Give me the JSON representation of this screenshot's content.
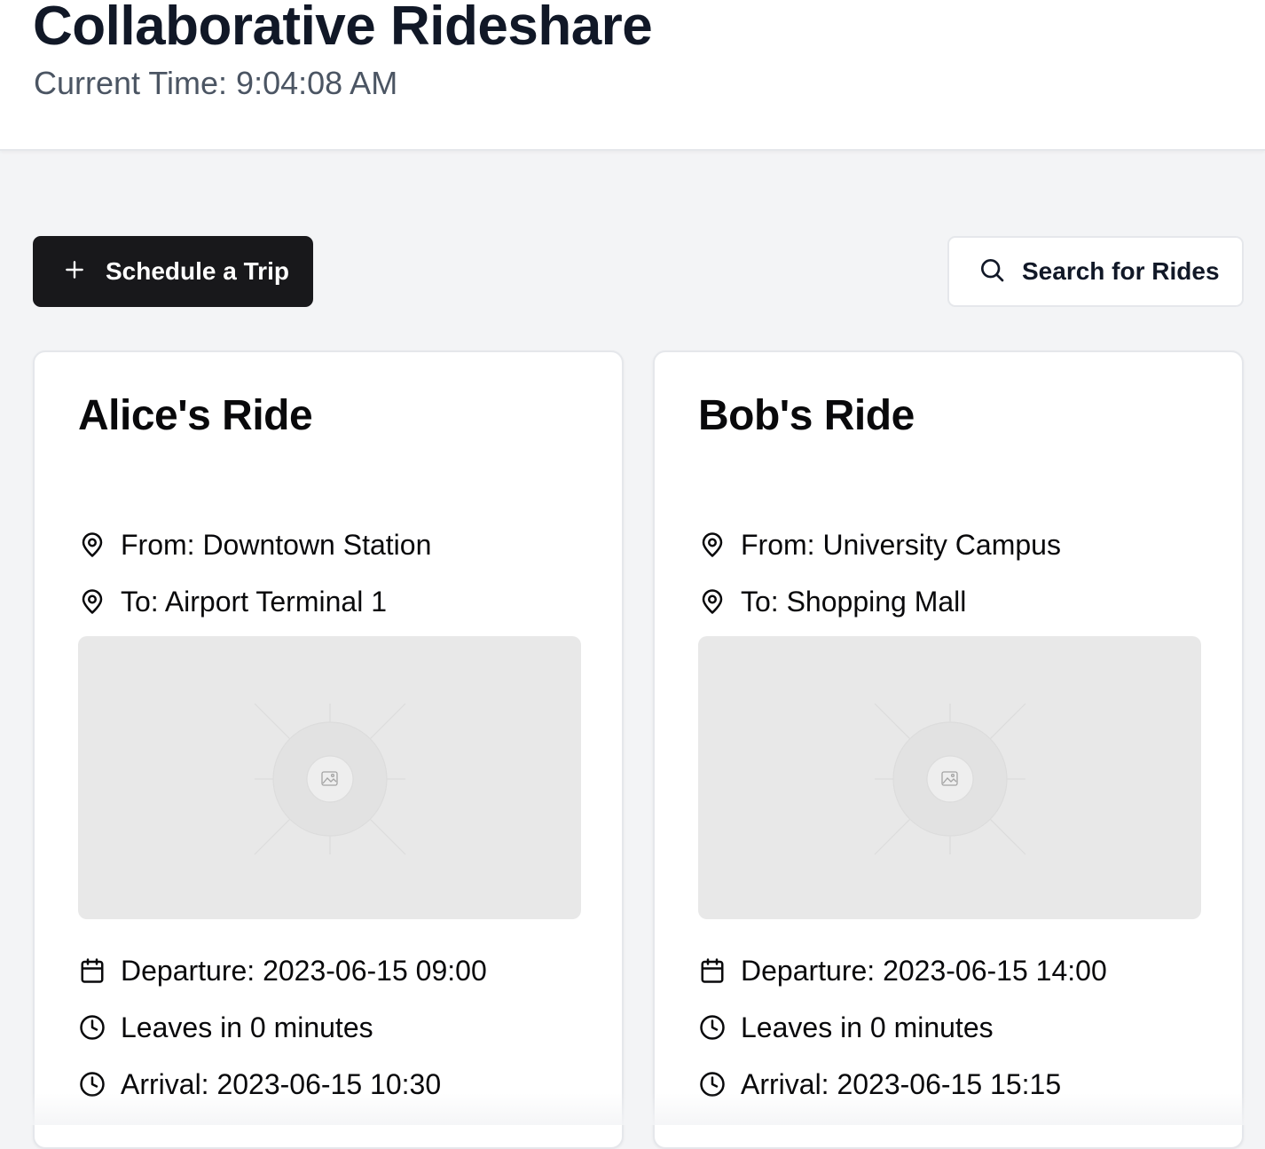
{
  "header": {
    "title": "Collaborative Rideshare",
    "current_time": "Current Time: 9:04:08 AM"
  },
  "actions": {
    "schedule": {
      "label": "Schedule a Trip",
      "icon": "plus-icon"
    },
    "search": {
      "label": "Search for Rides",
      "icon": "search-icon"
    }
  },
  "rides": [
    {
      "title": "Alice's Ride",
      "from": "From: Downtown Station",
      "to": "To: Airport Terminal 1",
      "departure": "Departure: 2023-06-15 09:00",
      "leaves_in": "Leaves in 0 minutes",
      "arrival": "Arrival: 2023-06-15 10:30"
    },
    {
      "title": "Bob's Ride",
      "from": "From: University Campus",
      "to": "To: Shopping Mall",
      "departure": "Departure: 2023-06-15 14:00",
      "leaves_in": "Leaves in 0 minutes",
      "arrival": "Arrival: 2023-06-15 15:15"
    }
  ],
  "icons": {
    "location": "map-pin-icon",
    "calendar": "calendar-icon",
    "clock": "clock-icon",
    "map_placeholder": "image-placeholder-icon"
  },
  "colors": {
    "primary_button": "#18181b",
    "page_background": "#f3f4f6",
    "card_background": "#ffffff",
    "map_placeholder": "#e8e8e8"
  }
}
